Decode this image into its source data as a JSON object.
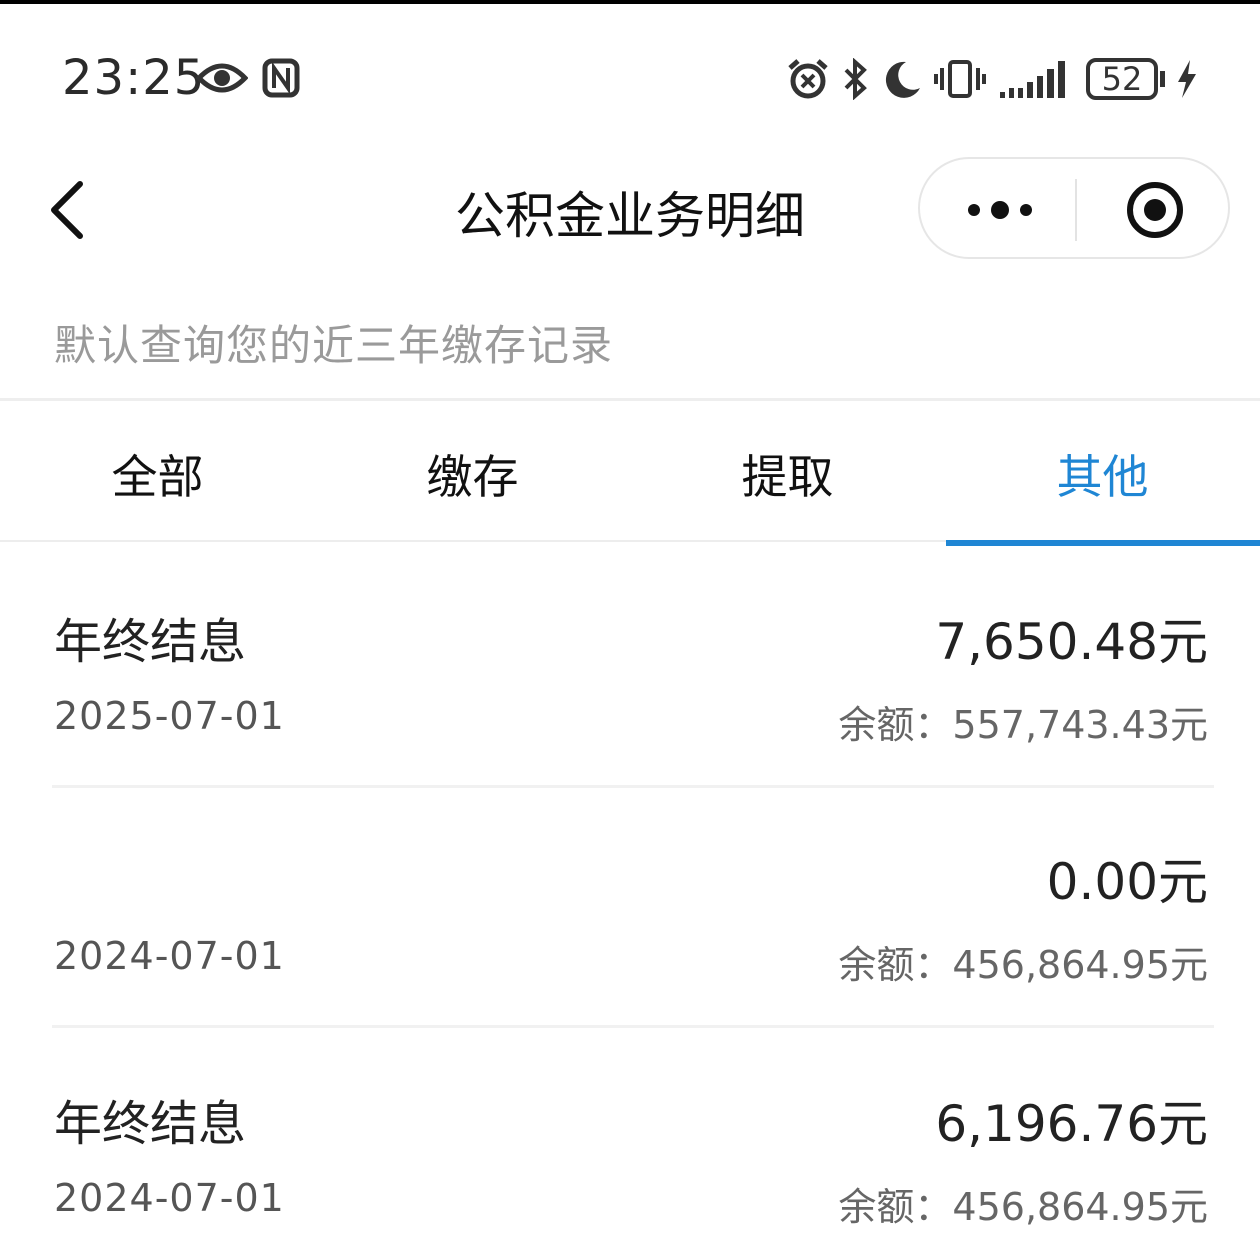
{
  "status_bar": {
    "time": "23:25",
    "battery": "52"
  },
  "header": {
    "title": "公积金业务明细"
  },
  "subtitle": "默认查询您的近三年缴存记录",
  "tabs": [
    {
      "label": "全部",
      "active": false
    },
    {
      "label": "缴存",
      "active": false
    },
    {
      "label": "提取",
      "active": false
    },
    {
      "label": "其他",
      "active": true
    }
  ],
  "records": [
    {
      "label": "年终结息",
      "amount": "7,650.48元",
      "date": "2025-07-01",
      "balance": "余额：557,743.43元"
    },
    {
      "label": "",
      "amount": "0.00元",
      "date": "2024-07-01",
      "balance": "余额：456,864.95元"
    },
    {
      "label": "年终结息",
      "amount": "6,196.76元",
      "date": "2024-07-01",
      "balance": "余额：456,864.95元"
    }
  ],
  "colors": {
    "accent": "#1f86d4",
    "text": "#222222",
    "muted": "#9a9a9a"
  }
}
